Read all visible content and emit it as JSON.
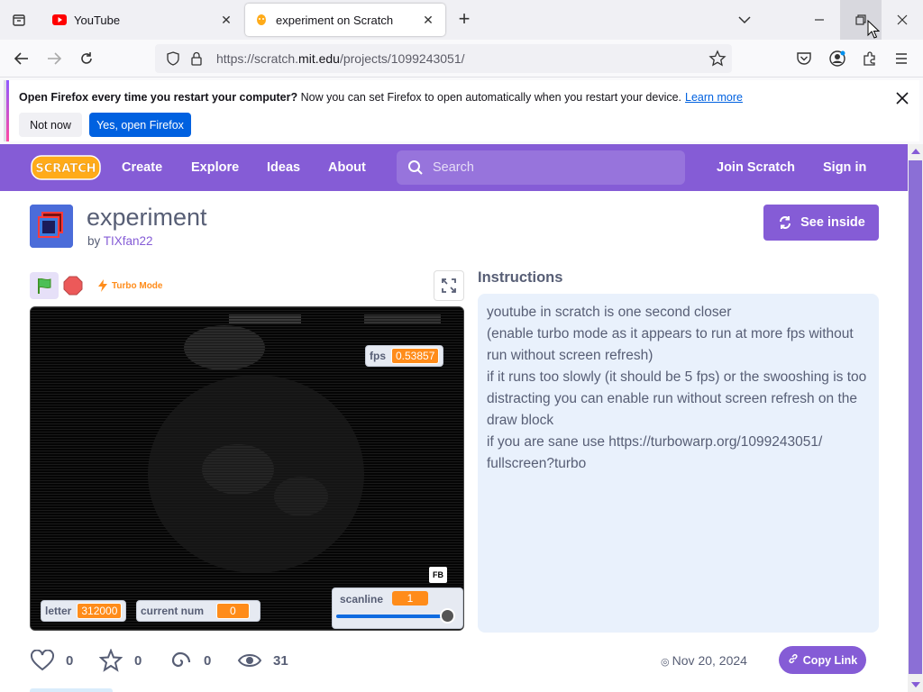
{
  "browser": {
    "tabs": [
      {
        "title": "YouTube",
        "favicon": "youtube-icon",
        "active": false
      },
      {
        "title": "experiment on Scratch",
        "favicon": "scratch-cat-icon",
        "active": true
      }
    ],
    "url_prefix": "https://scratch.",
    "url_domain": "mit.edu",
    "url_path": "/projects/1099243051/"
  },
  "notification": {
    "bold": "Open Firefox every time you restart your computer?",
    "text": " Now you can set Firefox to open automatically when you restart your device.",
    "link": "Learn more",
    "not_now": "Not now",
    "yes": "Yes, open Firefox"
  },
  "scratch_nav": {
    "logo": "SCRATCH",
    "links": [
      "Create",
      "Explore",
      "Ideas",
      "About"
    ],
    "search_placeholder": "Search",
    "join": "Join Scratch",
    "sign_in": "Sign in"
  },
  "project": {
    "title": "experiment",
    "by_prefix": "by ",
    "author": "TIXfan22",
    "see_inside": "See inside",
    "turbo_label": "Turbo Mode",
    "monitors": {
      "fps_label": "fps",
      "fps_value": "0.53857",
      "letter_label": "letter",
      "letter_value": "312000",
      "current_num_label": "current num",
      "current_num_value": "0",
      "scanline_label": "scanline",
      "scanline_value": "1",
      "scanline_slider_fraction": 0.98
    },
    "fb_badge": "FB",
    "instructions_title": "Instructions",
    "instructions": [
      "youtube in scratch is one second closer",
      "(enable turbo mode as it appears to run at more fps without run without screen refresh)",
      "if it runs too slowly (it should be 5 fps) or the swooshing is too distracting you can enable run without screen refresh on the draw block",
      "if you are sane use https://turbowarp.org/1099243051/ fullscreen?turbo"
    ],
    "stats": {
      "loves": "0",
      "favorites": "0",
      "remixes": "0",
      "views": "31"
    },
    "date": "Nov 20, 2024",
    "copy_link": "Copy Link"
  },
  "colors": {
    "scratch_purple": "#855cd6",
    "firefox_blue": "#0061e0",
    "monitor_orange": "#ff8c1a",
    "instructions_bg": "#e9f1fc"
  }
}
